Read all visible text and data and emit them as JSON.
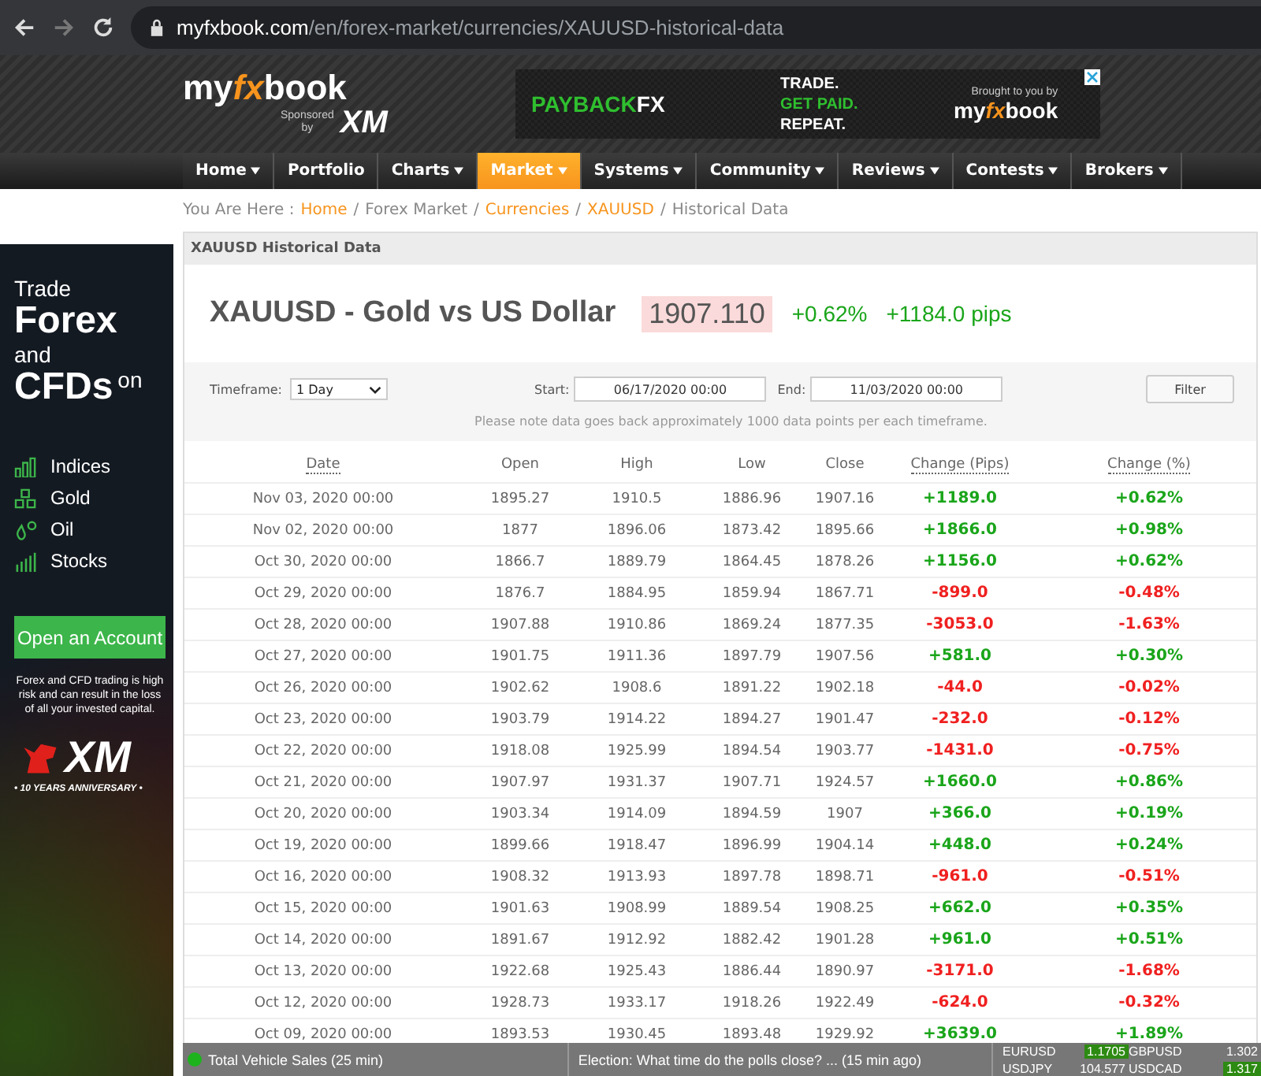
{
  "browser": {
    "url_host": "myfxbook.com",
    "url_path": "/en/forex-market/currencies/XAUUSD-historical-data"
  },
  "header": {
    "logo": [
      "my",
      "fx",
      "book"
    ],
    "sponsored": "Sponsored",
    "sponsored_by": "by",
    "sponsor_logo": "XM",
    "banner": {
      "brand_a": "PAYBACK",
      "brand_b": "FX",
      "lines": [
        {
          "text": "TRADE.",
          "accent": false
        },
        {
          "text": "GET PAID.",
          "accent": true
        },
        {
          "text": "REPEAT.",
          "accent": false
        }
      ],
      "credit": "Brought to you by",
      "credit_logo": [
        "my",
        "fx",
        "book"
      ]
    }
  },
  "nav": [
    {
      "label": "Home",
      "dropdown": true,
      "selected": false
    },
    {
      "label": "Portfolio",
      "dropdown": false,
      "selected": false
    },
    {
      "label": "Charts",
      "dropdown": true,
      "selected": false
    },
    {
      "label": "Market",
      "dropdown": true,
      "selected": true
    },
    {
      "label": "Systems",
      "dropdown": true,
      "selected": false
    },
    {
      "label": "Community",
      "dropdown": true,
      "selected": false
    },
    {
      "label": "Reviews",
      "dropdown": true,
      "selected": false
    },
    {
      "label": "Contests",
      "dropdown": true,
      "selected": false
    },
    {
      "label": "Brokers",
      "dropdown": true,
      "selected": false
    }
  ],
  "breadcrumb": {
    "prefix": "You Are Here :",
    "items": [
      {
        "text": "Home",
        "kind": "link"
      },
      {
        "text": "/",
        "kind": "separator"
      },
      {
        "text": "Forex Market",
        "kind": "text"
      },
      {
        "text": "/",
        "kind": "separator"
      },
      {
        "text": "Currencies",
        "kind": "link"
      },
      {
        "text": "/",
        "kind": "separator"
      },
      {
        "text": "XAUUSD",
        "kind": "link"
      },
      {
        "text": "/",
        "kind": "separator"
      },
      {
        "text": "Historical Data",
        "kind": "text"
      }
    ]
  },
  "side_ad": {
    "line1": "Trade",
    "line2": "Forex",
    "line3": "and",
    "line4": "CFDs",
    "line5": "on",
    "items": [
      {
        "kind": "bars",
        "label": "Indices"
      },
      {
        "kind": "blocks",
        "label": "Gold"
      },
      {
        "kind": "drops",
        "label": "Oil"
      },
      {
        "kind": "signal",
        "label": "Stocks"
      }
    ],
    "button": "Open an Account",
    "disclaimer": "Forex and CFD trading is high risk and can result in the loss of all your invested capital.",
    "logo": "XM",
    "tagline": "• 10 YEARS ANNIVERSARY •"
  },
  "panel": {
    "title": "XAUUSD Historical Data",
    "heading": "XAUUSD - Gold vs US Dollar",
    "price": "1907.110",
    "change_pct": "+0.62%",
    "change_pips": "+1184.0 pips",
    "up": true,
    "filter": {
      "timeframe_label": "Timeframe:",
      "timeframe": "1 Day",
      "start_label": "Start:",
      "start": "06/17/2020 00:00",
      "end_label": "End:",
      "end": "11/03/2020 00:00",
      "button": "Filter",
      "note": "Please note data goes back approximately 1000 data points per each timeframe."
    },
    "table": {
      "columns": [
        {
          "label": "Date",
          "tooltip": true
        },
        {
          "label": "Open",
          "tooltip": false
        },
        {
          "label": "High",
          "tooltip": false
        },
        {
          "label": "Low",
          "tooltip": false
        },
        {
          "label": "Close",
          "tooltip": false
        },
        {
          "label": "Change (Pips)",
          "tooltip": true
        },
        {
          "label": "Change (%)",
          "tooltip": true
        }
      ],
      "rows": [
        {
          "date": "Nov 03, 2020 00:00",
          "open": "1895.27",
          "high": "1910.5",
          "low": "1886.96",
          "close": "1907.16",
          "pips": "+1189.0",
          "pct": "+0.62%",
          "up": true
        },
        {
          "date": "Nov 02, 2020 00:00",
          "open": "1877",
          "high": "1896.06",
          "low": "1873.42",
          "close": "1895.66",
          "pips": "+1866.0",
          "pct": "+0.98%",
          "up": true
        },
        {
          "date": "Oct 30, 2020 00:00",
          "open": "1866.7",
          "high": "1889.79",
          "low": "1864.45",
          "close": "1878.26",
          "pips": "+1156.0",
          "pct": "+0.62%",
          "up": true
        },
        {
          "date": "Oct 29, 2020 00:00",
          "open": "1876.7",
          "high": "1884.95",
          "low": "1859.94",
          "close": "1867.71",
          "pips": "-899.0",
          "pct": "-0.48%",
          "up": false
        },
        {
          "date": "Oct 28, 2020 00:00",
          "open": "1907.88",
          "high": "1910.86",
          "low": "1869.24",
          "close": "1877.35",
          "pips": "-3053.0",
          "pct": "-1.63%",
          "up": false
        },
        {
          "date": "Oct 27, 2020 00:00",
          "open": "1901.75",
          "high": "1911.36",
          "low": "1897.79",
          "close": "1907.56",
          "pips": "+581.0",
          "pct": "+0.30%",
          "up": true
        },
        {
          "date": "Oct 26, 2020 00:00",
          "open": "1902.62",
          "high": "1908.6",
          "low": "1891.22",
          "close": "1902.18",
          "pips": "-44.0",
          "pct": "-0.02%",
          "up": false
        },
        {
          "date": "Oct 23, 2020 00:00",
          "open": "1903.79",
          "high": "1914.22",
          "low": "1894.27",
          "close": "1901.47",
          "pips": "-232.0",
          "pct": "-0.12%",
          "up": false
        },
        {
          "date": "Oct 22, 2020 00:00",
          "open": "1918.08",
          "high": "1925.99",
          "low": "1894.54",
          "close": "1903.77",
          "pips": "-1431.0",
          "pct": "-0.75%",
          "up": false
        },
        {
          "date": "Oct 21, 2020 00:00",
          "open": "1907.97",
          "high": "1931.37",
          "low": "1907.71",
          "close": "1924.57",
          "pips": "+1660.0",
          "pct": "+0.86%",
          "up": true
        },
        {
          "date": "Oct 20, 2020 00:00",
          "open": "1903.34",
          "high": "1914.09",
          "low": "1894.59",
          "close": "1907",
          "pips": "+366.0",
          "pct": "+0.19%",
          "up": true
        },
        {
          "date": "Oct 19, 2020 00:00",
          "open": "1899.66",
          "high": "1918.47",
          "low": "1896.99",
          "close": "1904.14",
          "pips": "+448.0",
          "pct": "+0.24%",
          "up": true
        },
        {
          "date": "Oct 16, 2020 00:00",
          "open": "1908.32",
          "high": "1913.93",
          "low": "1897.78",
          "close": "1898.71",
          "pips": "-961.0",
          "pct": "-0.51%",
          "up": false
        },
        {
          "date": "Oct 15, 2020 00:00",
          "open": "1901.63",
          "high": "1908.99",
          "low": "1889.54",
          "close": "1908.25",
          "pips": "+662.0",
          "pct": "+0.35%",
          "up": true
        },
        {
          "date": "Oct 14, 2020 00:00",
          "open": "1891.67",
          "high": "1912.92",
          "low": "1882.42",
          "close": "1901.28",
          "pips": "+961.0",
          "pct": "+0.51%",
          "up": true
        },
        {
          "date": "Oct 13, 2020 00:00",
          "open": "1922.68",
          "high": "1925.43",
          "low": "1886.44",
          "close": "1890.97",
          "pips": "-3171.0",
          "pct": "-1.68%",
          "up": false
        },
        {
          "date": "Oct 12, 2020 00:00",
          "open": "1928.73",
          "high": "1933.17",
          "low": "1918.26",
          "close": "1922.49",
          "pips": "-624.0",
          "pct": "-0.32%",
          "up": false
        },
        {
          "date": "Oct 09, 2020 00:00",
          "open": "1893.53",
          "high": "1930.45",
          "low": "1893.48",
          "close": "1929.92",
          "pips": "+3639.0",
          "pct": "+1.89%",
          "up": true
        }
      ]
    }
  },
  "news_bar": {
    "items": [
      "Total Vehicle Sales (25 min)",
      "Election: What time do the polls close? ...   (15 min ago)"
    ],
    "quotes": [
      {
        "symbol": "EURUSD",
        "value": "1.1705",
        "highlight": true
      },
      {
        "symbol": "GBPUSD",
        "value": "1.302",
        "highlight": false
      },
      {
        "symbol": "USDJPY",
        "value": "104.577",
        "highlight": false
      },
      {
        "symbol": "USDCAD",
        "value": "1.317",
        "highlight": true
      }
    ]
  }
}
